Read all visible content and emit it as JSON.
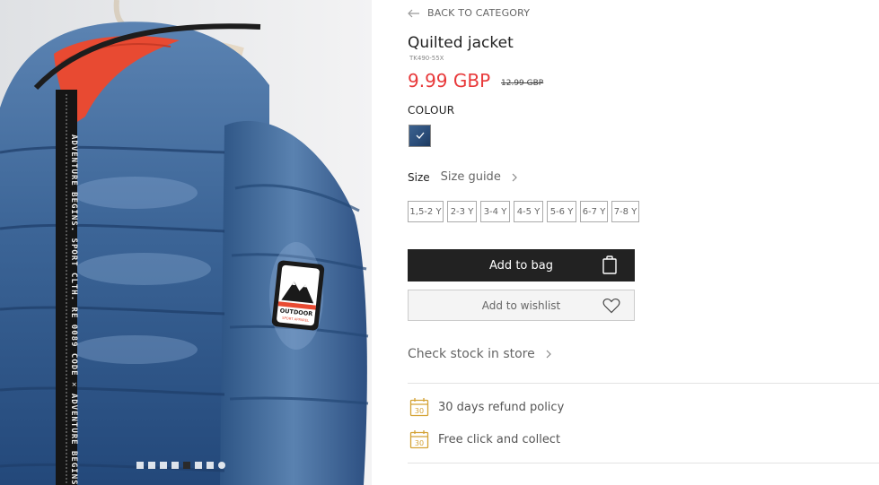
{
  "gallery": {
    "badge_text_top": "OUTDOOR",
    "badge_text_bottom": "SPORT APPAREL",
    "tape_text": "ADVENTURE BEGINS. SPORT CLTH. RE 0089 CODE ✕ ADVENTURE BEGINS"
  },
  "back": {
    "label": "BACK TO CATEGORY"
  },
  "product": {
    "title": "Quilted jacket",
    "sku": "TK490-55X",
    "price": "9.99 GBP",
    "old_price": "12.99 GBP"
  },
  "colour": {
    "label": "COLOUR",
    "selected_color": "#2e5580"
  },
  "size": {
    "label": "Size",
    "guide_label": "Size guide",
    "options": [
      "1,5-2 Y",
      "2-3 Y",
      "3-4 Y",
      "4-5 Y",
      "5-6 Y",
      "6-7 Y",
      "7-8 Y"
    ]
  },
  "actions": {
    "add_to_bag": "Add to bag",
    "add_to_wishlist": "Add to wishlist"
  },
  "stock": {
    "label": "Check stock in store"
  },
  "perks": [
    {
      "icon": "calendar-30-icon",
      "icon_text": "30",
      "label": "30 days refund policy"
    },
    {
      "icon": "calendar-30-icon",
      "icon_text": "30",
      "label": "Free click and collect"
    }
  ],
  "colors": {
    "price_red": "#e8393a",
    "button_dark": "#222222",
    "icon_gold": "#d4a235"
  }
}
